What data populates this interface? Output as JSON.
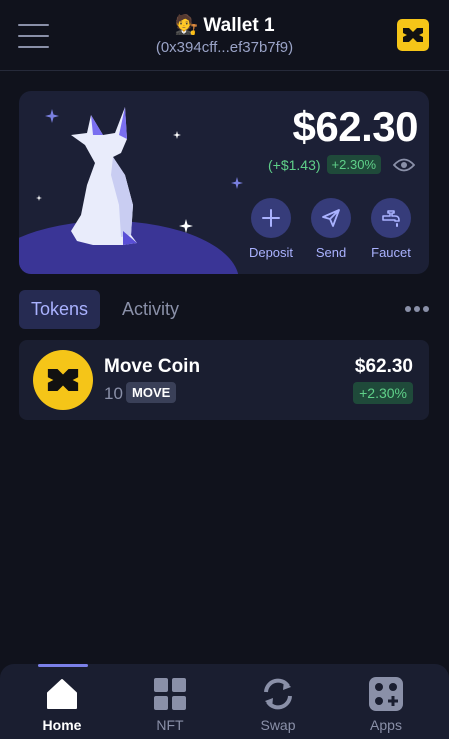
{
  "header": {
    "wallet_emoji": "🧑‍⚖️",
    "wallet_name": "Wallet 1",
    "address": "(0x394cff...ef37b7f9)"
  },
  "balance": {
    "total": "$62.30",
    "change_amount": "(+$1.43)",
    "change_percent": "+2.30%"
  },
  "actions": [
    {
      "label": "Deposit",
      "icon": "plus-icon"
    },
    {
      "label": "Send",
      "icon": "send-icon"
    },
    {
      "label": "Faucet",
      "icon": "faucet-icon"
    }
  ],
  "tabs": [
    {
      "label": "Tokens",
      "active": true
    },
    {
      "label": "Activity",
      "active": false
    }
  ],
  "tokens": [
    {
      "name": "Move Coin",
      "amount": "10",
      "symbol": "MOVE",
      "value": "$62.30",
      "change": "+2.30%"
    }
  ],
  "nav": [
    {
      "label": "Home",
      "icon": "home-icon",
      "active": true
    },
    {
      "label": "NFT",
      "icon": "grid-icon",
      "active": false
    },
    {
      "label": "Swap",
      "icon": "swap-icon",
      "active": false
    },
    {
      "label": "Apps",
      "icon": "apps-icon",
      "active": false
    }
  ],
  "colors": {
    "background": "#10121c",
    "card": "#1c2036",
    "accent": "#aab2ff",
    "positive": "#5fd089",
    "brand_yellow": "#f5c518"
  }
}
